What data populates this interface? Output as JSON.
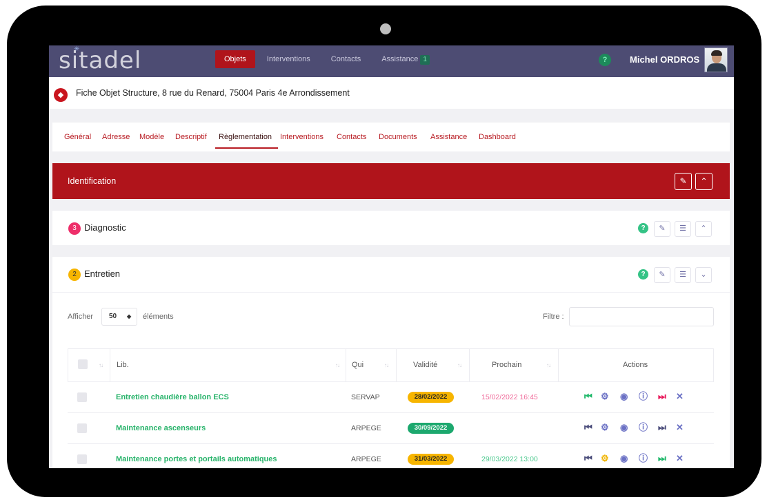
{
  "app": {
    "logo": "sitadel",
    "nav": [
      {
        "label": "Objets",
        "active": true
      },
      {
        "label": "Interventions",
        "active": false
      },
      {
        "label": "Contacts",
        "active": false
      },
      {
        "label": "Assistance",
        "active": false,
        "badge": "1"
      }
    ],
    "help_icon": "question-icon",
    "user_name": "Michel ORDROS"
  },
  "object": {
    "icon": "cube-icon",
    "title": "Fiche Objet Structure, 8 rue du Renard, 75004 Paris 4e Arrondissement"
  },
  "tabs": [
    "Général",
    "Adresse",
    "Modèle",
    "Descriptif",
    "Règlementation",
    "Interventions",
    "Contacts",
    "Documents",
    "Assistance",
    "Dashboard"
  ],
  "active_tab": "Règlementation",
  "identification": {
    "title": "Identification"
  },
  "diagnostic": {
    "count": "3",
    "title": "Diagnostic"
  },
  "entretien": {
    "count": "2",
    "title": "Entretien"
  },
  "table_controls": {
    "show_label": "Afficher",
    "page_size": "50",
    "show_suffix": "éléments",
    "filter_label": "Filtre :",
    "filter_value": ""
  },
  "table": {
    "columns": [
      "Lib.",
      "Qui",
      "Validité",
      "Prochain",
      "Actions"
    ],
    "rows": [
      {
        "lib": "Entretien chaudière ballon ECS",
        "qui": "SERVAP",
        "validite": "28/02/2022",
        "validite_color": "yellow",
        "prochain": "15/02/2022 16:45",
        "prochain_color": "#f06a9a"
      },
      {
        "lib": "Maintenance ascenseurs",
        "qui": "ARPEGE",
        "validite": "30/09/2022",
        "validite_color": "green",
        "prochain": "",
        "prochain_color": ""
      },
      {
        "lib": "Maintenance portes et portails automatiques",
        "qui": "ARPEGE",
        "validite": "31/03/2022",
        "validite_color": "yellow",
        "prochain": "29/03/2022 13:00",
        "prochain_color": "#4cc98e"
      }
    ]
  },
  "colors": {
    "brand_red": "#b0141b",
    "topbar": "#4d4c73",
    "lib_green": "#27b36a",
    "badge_yellow": "#f7b500",
    "badge_green": "#1ca86e"
  }
}
